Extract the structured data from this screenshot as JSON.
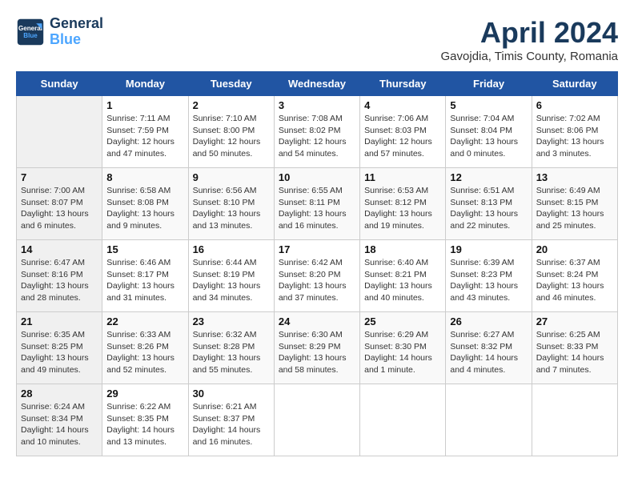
{
  "header": {
    "logo_line1": "General",
    "logo_line2": "Blue",
    "month_title": "April 2024",
    "location": "Gavojdia, Timis County, Romania"
  },
  "days_of_week": [
    "Sunday",
    "Monday",
    "Tuesday",
    "Wednesday",
    "Thursday",
    "Friday",
    "Saturday"
  ],
  "weeks": [
    [
      {
        "day": "",
        "info": ""
      },
      {
        "day": "1",
        "info": "Sunrise: 7:11 AM\nSunset: 7:59 PM\nDaylight: 12 hours\nand 47 minutes."
      },
      {
        "day": "2",
        "info": "Sunrise: 7:10 AM\nSunset: 8:00 PM\nDaylight: 12 hours\nand 50 minutes."
      },
      {
        "day": "3",
        "info": "Sunrise: 7:08 AM\nSunset: 8:02 PM\nDaylight: 12 hours\nand 54 minutes."
      },
      {
        "day": "4",
        "info": "Sunrise: 7:06 AM\nSunset: 8:03 PM\nDaylight: 12 hours\nand 57 minutes."
      },
      {
        "day": "5",
        "info": "Sunrise: 7:04 AM\nSunset: 8:04 PM\nDaylight: 13 hours\nand 0 minutes."
      },
      {
        "day": "6",
        "info": "Sunrise: 7:02 AM\nSunset: 8:06 PM\nDaylight: 13 hours\nand 3 minutes."
      }
    ],
    [
      {
        "day": "7",
        "info": "Sunrise: 7:00 AM\nSunset: 8:07 PM\nDaylight: 13 hours\nand 6 minutes."
      },
      {
        "day": "8",
        "info": "Sunrise: 6:58 AM\nSunset: 8:08 PM\nDaylight: 13 hours\nand 9 minutes."
      },
      {
        "day": "9",
        "info": "Sunrise: 6:56 AM\nSunset: 8:10 PM\nDaylight: 13 hours\nand 13 minutes."
      },
      {
        "day": "10",
        "info": "Sunrise: 6:55 AM\nSunset: 8:11 PM\nDaylight: 13 hours\nand 16 minutes."
      },
      {
        "day": "11",
        "info": "Sunrise: 6:53 AM\nSunset: 8:12 PM\nDaylight: 13 hours\nand 19 minutes."
      },
      {
        "day": "12",
        "info": "Sunrise: 6:51 AM\nSunset: 8:13 PM\nDaylight: 13 hours\nand 22 minutes."
      },
      {
        "day": "13",
        "info": "Sunrise: 6:49 AM\nSunset: 8:15 PM\nDaylight: 13 hours\nand 25 minutes."
      }
    ],
    [
      {
        "day": "14",
        "info": "Sunrise: 6:47 AM\nSunset: 8:16 PM\nDaylight: 13 hours\nand 28 minutes."
      },
      {
        "day": "15",
        "info": "Sunrise: 6:46 AM\nSunset: 8:17 PM\nDaylight: 13 hours\nand 31 minutes."
      },
      {
        "day": "16",
        "info": "Sunrise: 6:44 AM\nSunset: 8:19 PM\nDaylight: 13 hours\nand 34 minutes."
      },
      {
        "day": "17",
        "info": "Sunrise: 6:42 AM\nSunset: 8:20 PM\nDaylight: 13 hours\nand 37 minutes."
      },
      {
        "day": "18",
        "info": "Sunrise: 6:40 AM\nSunset: 8:21 PM\nDaylight: 13 hours\nand 40 minutes."
      },
      {
        "day": "19",
        "info": "Sunrise: 6:39 AM\nSunset: 8:23 PM\nDaylight: 13 hours\nand 43 minutes."
      },
      {
        "day": "20",
        "info": "Sunrise: 6:37 AM\nSunset: 8:24 PM\nDaylight: 13 hours\nand 46 minutes."
      }
    ],
    [
      {
        "day": "21",
        "info": "Sunrise: 6:35 AM\nSunset: 8:25 PM\nDaylight: 13 hours\nand 49 minutes."
      },
      {
        "day": "22",
        "info": "Sunrise: 6:33 AM\nSunset: 8:26 PM\nDaylight: 13 hours\nand 52 minutes."
      },
      {
        "day": "23",
        "info": "Sunrise: 6:32 AM\nSunset: 8:28 PM\nDaylight: 13 hours\nand 55 minutes."
      },
      {
        "day": "24",
        "info": "Sunrise: 6:30 AM\nSunset: 8:29 PM\nDaylight: 13 hours\nand 58 minutes."
      },
      {
        "day": "25",
        "info": "Sunrise: 6:29 AM\nSunset: 8:30 PM\nDaylight: 14 hours\nand 1 minute."
      },
      {
        "day": "26",
        "info": "Sunrise: 6:27 AM\nSunset: 8:32 PM\nDaylight: 14 hours\nand 4 minutes."
      },
      {
        "day": "27",
        "info": "Sunrise: 6:25 AM\nSunset: 8:33 PM\nDaylight: 14 hours\nand 7 minutes."
      }
    ],
    [
      {
        "day": "28",
        "info": "Sunrise: 6:24 AM\nSunset: 8:34 PM\nDaylight: 14 hours\nand 10 minutes."
      },
      {
        "day": "29",
        "info": "Sunrise: 6:22 AM\nSunset: 8:35 PM\nDaylight: 14 hours\nand 13 minutes."
      },
      {
        "day": "30",
        "info": "Sunrise: 6:21 AM\nSunset: 8:37 PM\nDaylight: 14 hours\nand 16 minutes."
      },
      {
        "day": "",
        "info": ""
      },
      {
        "day": "",
        "info": ""
      },
      {
        "day": "",
        "info": ""
      },
      {
        "day": "",
        "info": ""
      }
    ]
  ]
}
